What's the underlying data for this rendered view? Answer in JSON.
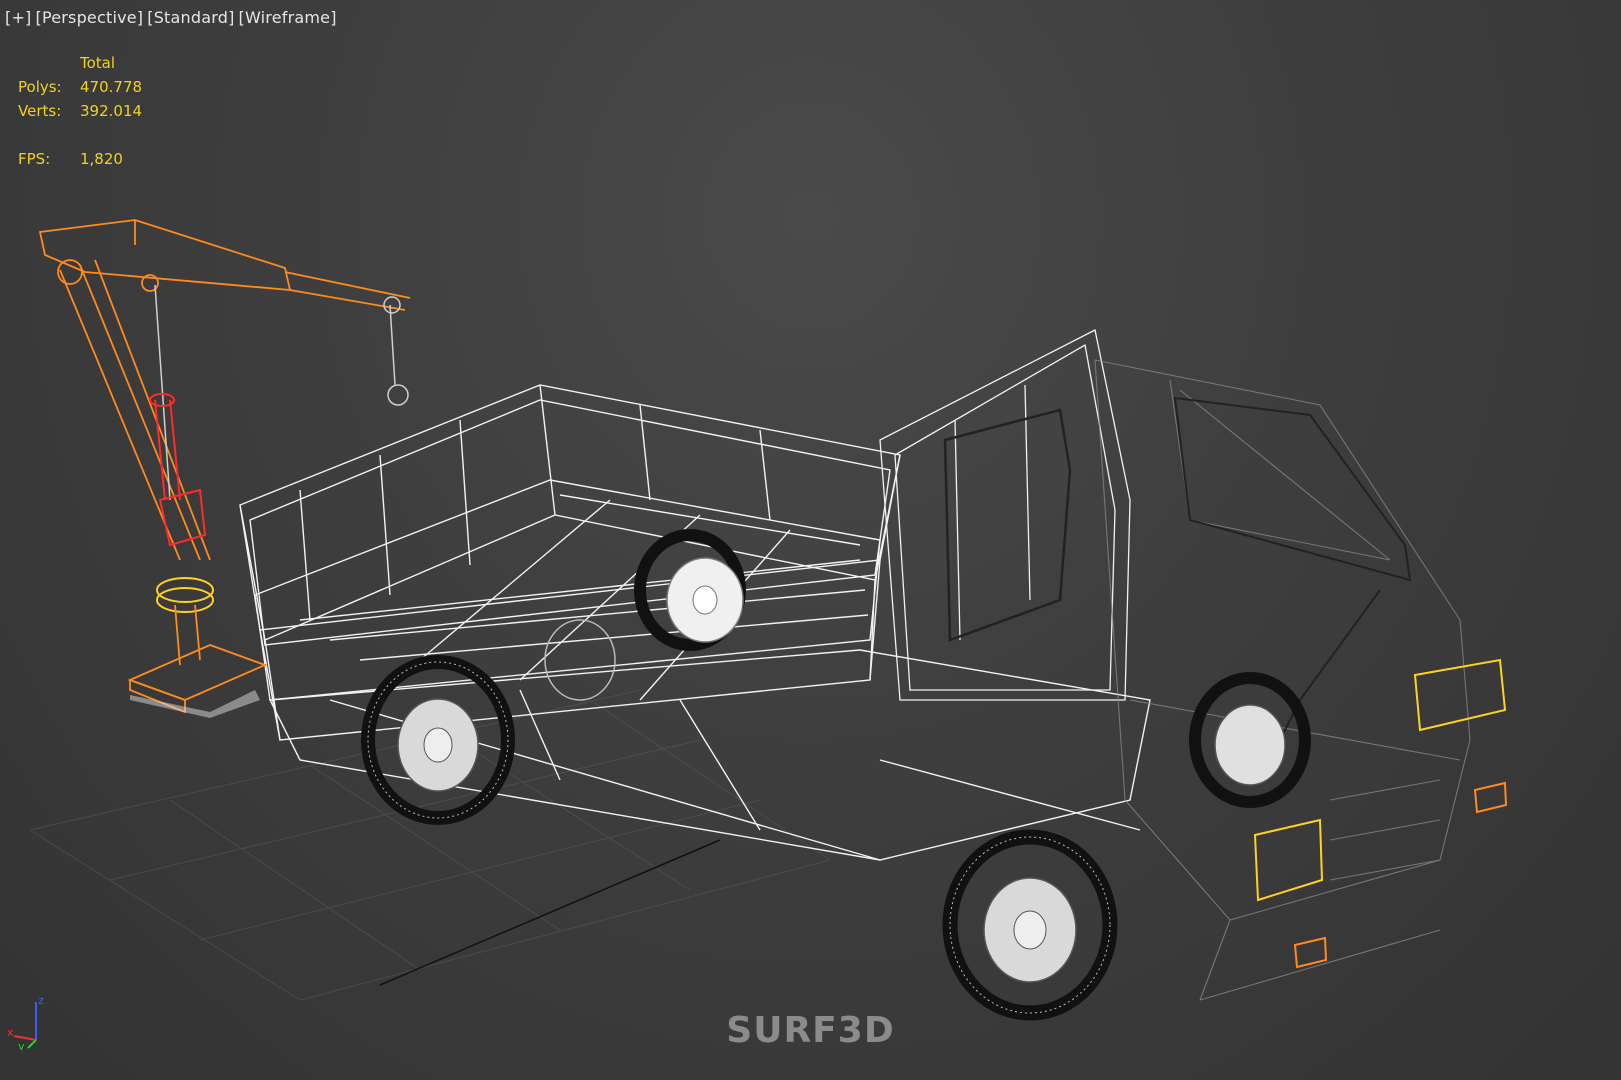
{
  "viewport": {
    "labels": [
      "[+]",
      "[Perspective]",
      "[Standard]",
      "[Wireframe]"
    ]
  },
  "stats": {
    "header": "Total",
    "polys_label": "Polys:",
    "polys_value": "470.778",
    "verts_label": "Verts:",
    "verts_value": "392.014",
    "fps_label": "FPS:",
    "fps_value": "1,820"
  },
  "gizmo": {
    "x": "x",
    "y": "y",
    "z": "z"
  },
  "watermark": "SURF3D",
  "colors": {
    "background": "#3e3e3e",
    "stats_text": "#f0d21e",
    "wire_white": "#f2f2f2",
    "crane_orange": "#ff8a1e",
    "crane_red": "#ff2a2a",
    "highlight_yellow": "#ffd21e"
  },
  "icons": [
    "axis-gizmo-icon"
  ]
}
